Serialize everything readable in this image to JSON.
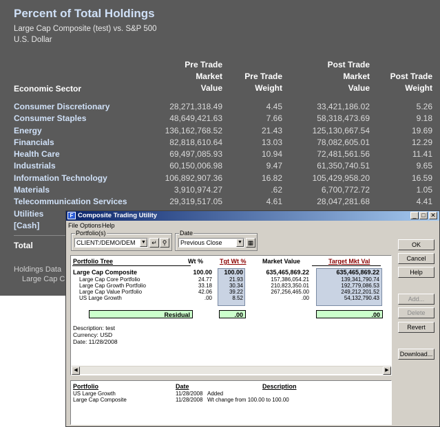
{
  "report": {
    "title": "Percent of Total Holdings",
    "subtitle": "Large Cap Composite (test) vs. S&P 500",
    "currency": "U.S. Dollar",
    "headers": {
      "sector": "Economic Sector",
      "c1": [
        "Pre Trade",
        "Market",
        "Value"
      ],
      "c2": [
        "Pre Trade",
        "Weight"
      ],
      "c3": [
        "Post Trade",
        "Market",
        "Value"
      ],
      "c4": [
        "Post Trade",
        "Weight"
      ]
    },
    "rows": [
      {
        "name": "Consumer Discretionary",
        "pre_value": "28,271,318.49",
        "pre_weight": "4.45",
        "post_value": "33,421,186.02",
        "post_weight": "5.26"
      },
      {
        "name": "Consumer Staples",
        "pre_value": "48,649,421.63",
        "pre_weight": "7.66",
        "post_value": "58,318,473.69",
        "post_weight": "9.18"
      },
      {
        "name": "Energy",
        "pre_value": "136,162,768.52",
        "pre_weight": "21.43",
        "post_value": "125,130,667.54",
        "post_weight": "19.69"
      },
      {
        "name": "Financials",
        "pre_value": "82,818,610.64",
        "pre_weight": "13.03",
        "post_value": "78,082,605.01",
        "post_weight": "12.29"
      },
      {
        "name": "Health Care",
        "pre_value": "69,497,085.93",
        "pre_weight": "10.94",
        "post_value": "72,481,561.56",
        "post_weight": "11.41"
      },
      {
        "name": "Industrials",
        "pre_value": "60,150,006.98",
        "pre_weight": "9.47",
        "post_value": "61,350,740.51",
        "post_weight": "9.65"
      },
      {
        "name": "Information Technology",
        "pre_value": "106,892,907.36",
        "pre_weight": "16.82",
        "post_value": "105,429,958.20",
        "post_weight": "16.59"
      },
      {
        "name": "Materials",
        "pre_value": "3,910,974.27",
        "pre_weight": ".62",
        "post_value": "6,700,772.72",
        "post_weight": "1.05"
      },
      {
        "name": "Telecommunication Services",
        "pre_value": "29,319,517.05",
        "pre_weight": "4.61",
        "post_value": "28,047,281.68",
        "post_weight": "4.41"
      },
      {
        "name": "Utilities",
        "pre_value": "",
        "pre_weight": "",
        "post_value": "",
        "post_weight": ""
      },
      {
        "name": "[Cash]",
        "pre_value": "",
        "pre_weight": "",
        "post_value": "",
        "post_weight": ""
      }
    ],
    "total_label": "Total",
    "footer_line1": "Holdings Data",
    "footer_line2": "Large Cap C"
  },
  "dialog": {
    "title": "Composite Trading Utility",
    "app_icon": "F",
    "menu": [
      "File",
      "Options",
      "Help"
    ],
    "portfolio_group_label": "Portfolio(s)",
    "portfolio_value": "CLIENT:/DEMO/DEM",
    "date_group_label": "Date",
    "date_value": "Previous Close",
    "tree_headers": {
      "tree": "Portfolio Tree",
      "wt": "Wt %",
      "tgt": "Tgt Wt %",
      "mv": "Market Value",
      "tmv": "Target Mkt Val"
    },
    "tree_rows": [
      {
        "name": "Large Cap Composite",
        "wt": "100.00",
        "tgt": "100.00",
        "mv": "635,465,869.22",
        "tmv": "635,465,869.22"
      },
      {
        "name": "Large Cap Core Portfolio",
        "wt": "24.77",
        "tgt": "21.93",
        "mv": "157,386,054.21",
        "tmv": "139,341,790.74"
      },
      {
        "name": "Large Cap Growth Portfolio",
        "wt": "33.18",
        "tgt": "30.34",
        "mv": "210,823,350.01",
        "tmv": "192,779,086.53"
      },
      {
        "name": "Large Cap Value Portfolio",
        "wt": "42.06",
        "tgt": "39.22",
        "mv": "267,256,465.00",
        "tmv": "249,212,201.52"
      },
      {
        "name": "US Large Growth",
        "wt": ".00",
        "tgt": "8.52",
        "mv": ".00",
        "tmv": "54,132,790.43"
      }
    ],
    "residual_label": "Residual",
    "residual_tgt": ".00",
    "residual_tmv": ".00",
    "description": "Description: test",
    "currency": "Currency: USD",
    "date": "Date: 11/28/2008",
    "log_headers": {
      "portfolio": "Portfolio",
      "date": "Date",
      "description": "Description"
    },
    "log_rows": [
      {
        "portfolio": "US Large Growth",
        "date": "11/28/2008",
        "description": "Added"
      },
      {
        "portfolio": "Large Cap Composite",
        "date": "11/28/2008",
        "description": "Wt change from 100.00 to 100.00"
      }
    ],
    "buttons": {
      "ok": "OK",
      "cancel": "Cancel",
      "help": "Help",
      "add": "Add...",
      "delete": "Delete",
      "revert": "Revert",
      "download": "Download..."
    }
  }
}
